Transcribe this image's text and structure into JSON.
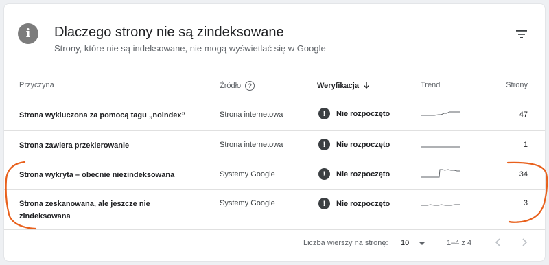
{
  "header": {
    "title": "Dlaczego strony nie są zindeksowane",
    "subtitle": "Strony, które nie są indeksowane, nie mogą wyświetlać się w Google",
    "info_icon": "info-icon",
    "filter_icon": "filter-icon"
  },
  "table": {
    "columns": {
      "reason": "Przyczyna",
      "source": "Źródło",
      "verification": "Weryfikacja",
      "trend": "Trend",
      "pages": "Strony"
    },
    "rows": [
      {
        "reason": "Strona wykluczona za pomocą tagu „noindex”",
        "source": "Strona internetowa",
        "status": "Nie rozpoczęto",
        "pages": "47"
      },
      {
        "reason": "Strona zawiera przekierowanie",
        "source": "Strona internetowa",
        "status": "Nie rozpoczęto",
        "pages": "1"
      },
      {
        "reason": "Strona wykryta – obecnie niezindeksowana",
        "source": "Systemy Google",
        "status": "Nie rozpoczęto",
        "pages": "34"
      },
      {
        "reason": "Strona zeskanowana, ale jeszcze nie zindeksowana",
        "source": "Systemy Google",
        "status": "Nie rozpoczęto",
        "pages": "3"
      }
    ]
  },
  "pagination": {
    "rows_per_page_label": "Liczba wierszy na stronę:",
    "rows_per_page_value": "10",
    "range": "1–4 z 4"
  },
  "colors": {
    "annotation": "#e8601c",
    "status_icon": "#3c4043"
  }
}
